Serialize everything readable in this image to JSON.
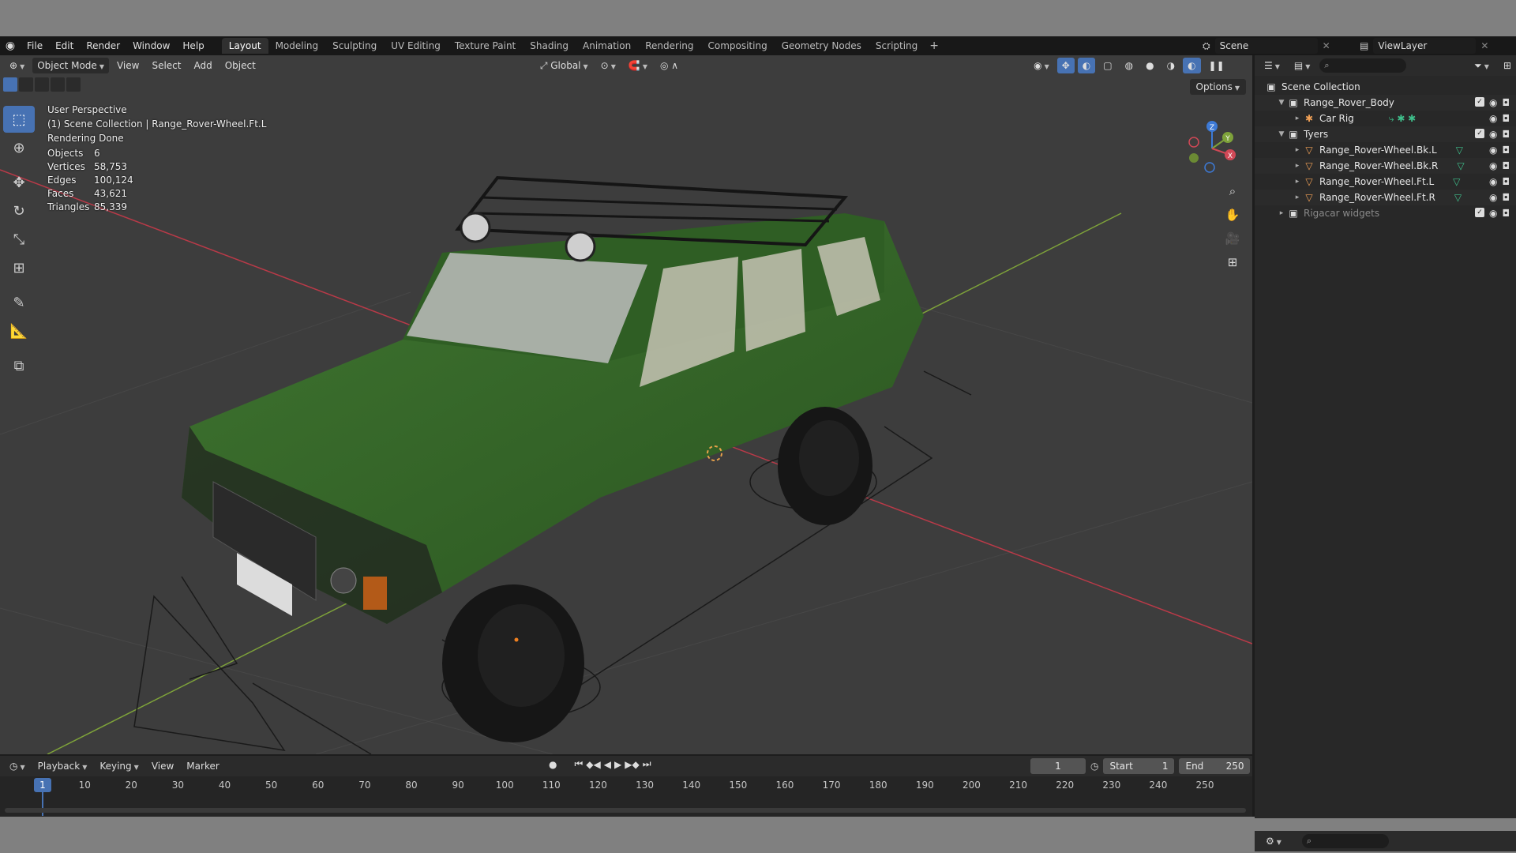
{
  "topbar": {
    "menus": [
      "File",
      "Edit",
      "Render",
      "Window",
      "Help"
    ],
    "workspaces": [
      "Layout",
      "Modeling",
      "Sculpting",
      "UV Editing",
      "Texture Paint",
      "Shading",
      "Animation",
      "Rendering",
      "Compositing",
      "Geometry Nodes",
      "Scripting"
    ],
    "active_workspace": "Layout",
    "add_tab": "+",
    "scene": "Scene",
    "view_layer": "ViewLayer"
  },
  "viewport_header": {
    "mode": "Object Mode",
    "menus": [
      "View",
      "Select",
      "Add",
      "Object"
    ],
    "orientation": "Global",
    "options": "Options"
  },
  "overlay": {
    "perspective": "User Perspective",
    "collection": "(1) Scene Collection | Range_Rover-Wheel.Ft.L",
    "status": "Rendering Done",
    "stats": [
      {
        "k": "Objects",
        "v": "6"
      },
      {
        "k": "Vertices",
        "v": "58,753"
      },
      {
        "k": "Edges",
        "v": "100,124"
      },
      {
        "k": "Faces",
        "v": "43,621"
      },
      {
        "k": "Triangles",
        "v": "85,339"
      }
    ]
  },
  "gizmo": {
    "x": "X",
    "y": "Y",
    "z": "Z"
  },
  "timeline": {
    "menus": [
      "Playback",
      "Keying",
      "View",
      "Marker"
    ],
    "current_frame": "1",
    "start_label": "Start",
    "start": "1",
    "end_label": "End",
    "end": "250",
    "ticks": [
      "1",
      "10",
      "20",
      "30",
      "40",
      "50",
      "60",
      "70",
      "80",
      "90",
      "100",
      "110",
      "120",
      "130",
      "140",
      "150",
      "160",
      "170",
      "180",
      "190",
      "200",
      "210",
      "220",
      "230",
      "240",
      "250"
    ]
  },
  "outliner": {
    "root": "Scene Collection",
    "rows": [
      {
        "label": "Range_Rover_Body",
        "type": "collection",
        "indent": 1
      },
      {
        "label": "Car Rig",
        "type": "rig",
        "indent": 2
      },
      {
        "label": "Tyers",
        "type": "collection",
        "indent": 1
      },
      {
        "label": "Range_Rover-Wheel.Bk.L",
        "type": "mesh",
        "indent": 2
      },
      {
        "label": "Range_Rover-Wheel.Bk.R",
        "type": "mesh",
        "indent": 2
      },
      {
        "label": "Range_Rover-Wheel.Ft.L",
        "type": "mesh",
        "indent": 2
      },
      {
        "label": "Range_Rover-Wheel.Ft.R",
        "type": "mesh",
        "indent": 2
      },
      {
        "label": "Rigacar widgets",
        "type": "collection",
        "indent": 1
      }
    ]
  },
  "colors": {
    "accent": "#4772b3",
    "car_green": "#3a6a2a",
    "grid_red": "#b93a48",
    "grid_green": "#7ea23a"
  }
}
